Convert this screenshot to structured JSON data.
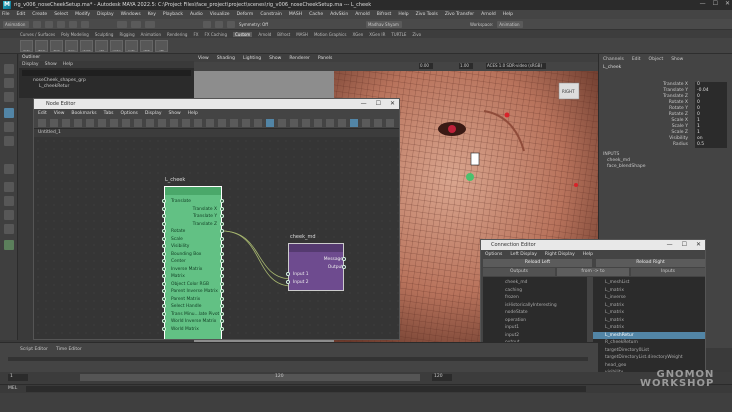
{
  "window": {
    "title": "rig_v006_noseCheekSetup.ma* - Autodesk MAYA 2022.5: C:\\Project Files\\face_project\\project\\scenes\\rig_v006_noseCheekSetup.ma --- L_cheek",
    "minimize": "—",
    "maximize": "☐",
    "close": "✕"
  },
  "menubar": [
    "File",
    "Edit",
    "Create",
    "Select",
    "Modify",
    "Display",
    "Windows",
    "Key",
    "Playback",
    "Audio",
    "Visualize",
    "Deform",
    "Constrain",
    "MASH",
    "Cache",
    "AdvSkin",
    "Arnold",
    "Bifrost",
    "Help",
    "Zivo Tools",
    "Zivo Transfer",
    "Arnold",
    "Help"
  ],
  "statusline": {
    "mode": "Animation",
    "symmetry": "Symmetry: Off",
    "user": "Madhav Shyam",
    "workspace": "Workspace:",
    "workspace_value": "Animation"
  },
  "shelf_tabs": [
    "Curves / Surfaces",
    "Poly Modeling",
    "Sculpting",
    "Rigging",
    "Animation",
    "Rendering",
    "FX",
    "FX Caching",
    "Custom",
    "Arnold",
    "Bifrost",
    "MASH",
    "Motion Graphics",
    "XGen",
    "XGen IR",
    "TURTLE",
    "Zivo"
  ],
  "shelf_active": "Custom",
  "shelf_buttons": [
    "skdn",
    "dkUp",
    "dkrk",
    "ctcrv",
    "sbdrk",
    "ctrl",
    "cmbn",
    "pvtp",
    "vtCS",
    "vtC"
  ],
  "outliner": {
    "menu": [
      "Outliner",
      "Display",
      "Show",
      "Help"
    ],
    "items": [
      "noseCheek_shapes_grp",
      "L_cheekRetur"
    ]
  },
  "viewport": {
    "menu": [
      "View",
      "Shading",
      "Lighting",
      "Show",
      "Renderer",
      "Panels"
    ],
    "frame": "0.00",
    "scale": "1.00",
    "color_space": "ACES 1.0 SDR-video (sRGB)",
    "view_cube": "RIGHT"
  },
  "node_editor": {
    "title": "Node Editor",
    "menu": [
      "Edit",
      "View",
      "Bookmarks",
      "Tabs",
      "Options",
      "Display",
      "Show",
      "Help"
    ],
    "tab": "Untitled_1",
    "green_node": {
      "name": "L_cheek",
      "attrs": [
        "Translate",
        "Translate X",
        "Translate Y",
        "Translate Z",
        "Rotate",
        "Scale",
        "Visibility",
        "Bounding Box",
        "Center",
        "Inverse Matrix",
        "Matrix",
        "Object Color RGB",
        "Parent Inverse Matrix",
        "Parent Matrix",
        "Select Handle",
        "Trans Minu...late Pivot",
        "World Inverse Matrix",
        "World Matrix"
      ]
    },
    "purple_node": {
      "name": "cheek_md",
      "attrs": [
        "Message",
        "Output",
        "Input 1",
        "Input 2"
      ]
    }
  },
  "channel_box": {
    "menu": [
      "Channels",
      "Edit",
      "Object",
      "Show"
    ],
    "object": "L_cheek",
    "channels": [
      {
        "label": "Translate X",
        "value": "0"
      },
      {
        "label": "Translate Y",
        "value": "-0.04"
      },
      {
        "label": "Translate Z",
        "value": "0"
      },
      {
        "label": "Rotate X",
        "value": "0"
      },
      {
        "label": "Rotate Y",
        "value": "0"
      },
      {
        "label": "Rotate Z",
        "value": "0"
      },
      {
        "label": "Scale X",
        "value": "1"
      },
      {
        "label": "Scale Y",
        "value": "1"
      },
      {
        "label": "Scale Z",
        "value": "1"
      },
      {
        "label": "Visibility",
        "value": "on"
      },
      {
        "label": "Radius",
        "value": "0.5"
      }
    ],
    "inputs_label": "INPUTS",
    "inputs": [
      "cheek_md",
      "face_blendShape"
    ]
  },
  "conn_editor": {
    "title": "Connection Editor",
    "menu": [
      "Options",
      "Left Display",
      "Right Display",
      "Help"
    ],
    "reload_left": "Reload Left",
    "reload_right": "Reload Right",
    "col_outputs": "Outputs",
    "col_from_to": "from -> to",
    "col_inputs": "Inputs",
    "left_items": [
      "cheek_md",
      "caching",
      "frozen",
      "isHistoricallyInteresting",
      "nodeState",
      "operation",
      "input1",
      "input2",
      "output",
      "outputX",
      "outputY",
      "outputZ"
    ],
    "left_selected": "outputX",
    "right_items": [
      "L_meshList",
      "L_matrix",
      "L_inverse",
      "L_matrix",
      "L_matrix",
      "L_matrix",
      "L_matrix",
      "L_meshRetur",
      "R_cheekReturn",
      "targetDirectory0List",
      "targetDirectoryList.directoryWeight",
      "head_geo",
      "visibility"
    ],
    "right_selected": "L_meshRetur"
  },
  "timeline": {
    "start": "1",
    "end": "120",
    "end2": "120",
    "label": "Script Editor",
    "tab2": "Time Editor"
  },
  "melbar": {
    "label": "MEL"
  },
  "watermark": {
    "line1": "GNOMON",
    "line2": "WORKSHOP"
  }
}
